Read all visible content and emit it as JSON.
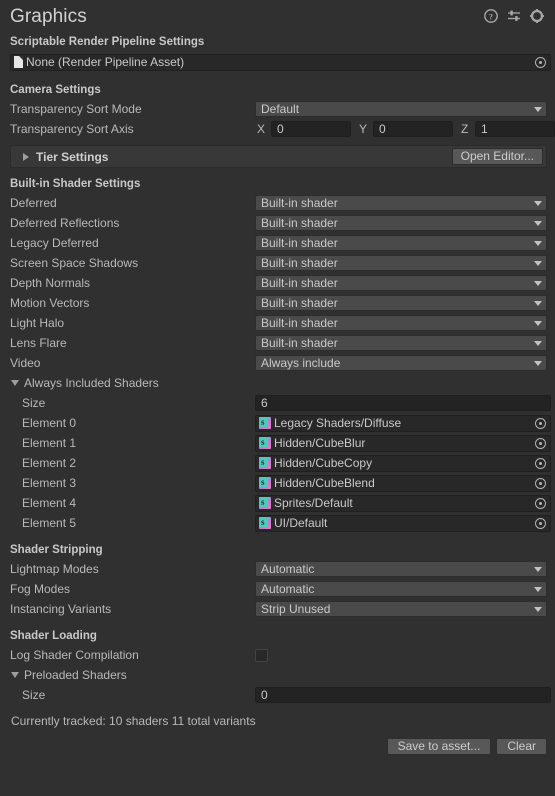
{
  "window": {
    "title": "Graphics",
    "icons": [
      "help-icon",
      "preset-icon",
      "gear-icon"
    ]
  },
  "srp": {
    "header": "Scriptable Render Pipeline Settings",
    "asset_value": "None (Render Pipeline Asset)"
  },
  "camera": {
    "header": "Camera Settings",
    "transparency_sort_mode": {
      "label": "Transparency Sort Mode",
      "value": "Default"
    },
    "transparency_sort_axis": {
      "label": "Transparency Sort Axis",
      "x_label": "X",
      "x": "0",
      "y_label": "Y",
      "y": "0",
      "z_label": "Z",
      "z": "1"
    }
  },
  "tier_settings": {
    "label": "Tier Settings",
    "open_editor_button": "Open Editor..."
  },
  "builtin_shaders": {
    "header": "Built-in Shader Settings",
    "rows": [
      {
        "label": "Deferred",
        "value": "Built-in shader"
      },
      {
        "label": "Deferred Reflections",
        "value": "Built-in shader"
      },
      {
        "label": "Legacy Deferred",
        "value": "Built-in shader"
      },
      {
        "label": "Screen Space Shadows",
        "value": "Built-in shader"
      },
      {
        "label": "Depth Normals",
        "value": "Built-in shader"
      },
      {
        "label": "Motion Vectors",
        "value": "Built-in shader"
      },
      {
        "label": "Light Halo",
        "value": "Built-in shader"
      },
      {
        "label": "Lens Flare",
        "value": "Built-in shader"
      },
      {
        "label": "Video",
        "value": "Always include"
      }
    ]
  },
  "always_included_shaders": {
    "label": "Always Included Shaders",
    "size_label": "Size",
    "size_value": "6",
    "elements": [
      {
        "label": "Element 0",
        "value": "Legacy Shaders/Diffuse"
      },
      {
        "label": "Element 1",
        "value": "Hidden/CubeBlur"
      },
      {
        "label": "Element 2",
        "value": "Hidden/CubeCopy"
      },
      {
        "label": "Element 3",
        "value": "Hidden/CubeBlend"
      },
      {
        "label": "Element 4",
        "value": "Sprites/Default"
      },
      {
        "label": "Element 5",
        "value": "UI/Default"
      }
    ]
  },
  "shader_stripping": {
    "header": "Shader Stripping",
    "rows": [
      {
        "label": "Lightmap Modes",
        "value": "Automatic"
      },
      {
        "label": "Fog Modes",
        "value": "Automatic"
      },
      {
        "label": "Instancing Variants",
        "value": "Strip Unused"
      }
    ]
  },
  "shader_loading": {
    "header": "Shader Loading",
    "log_shader_compilation_label": "Log Shader Compilation",
    "log_shader_compilation_checked": false,
    "preloaded_shaders_label": "Preloaded Shaders",
    "size_label": "Size",
    "size_value": "0",
    "status": "Currently tracked: 10 shaders 11 total variants",
    "save_button": "Save to asset...",
    "clear_button": "Clear"
  },
  "colors": {
    "background": "#303030",
    "popup": "#4a4a4a",
    "textfield": "#232323",
    "text": "#b9b9b9",
    "shader_icon": "#4ec9bd"
  }
}
